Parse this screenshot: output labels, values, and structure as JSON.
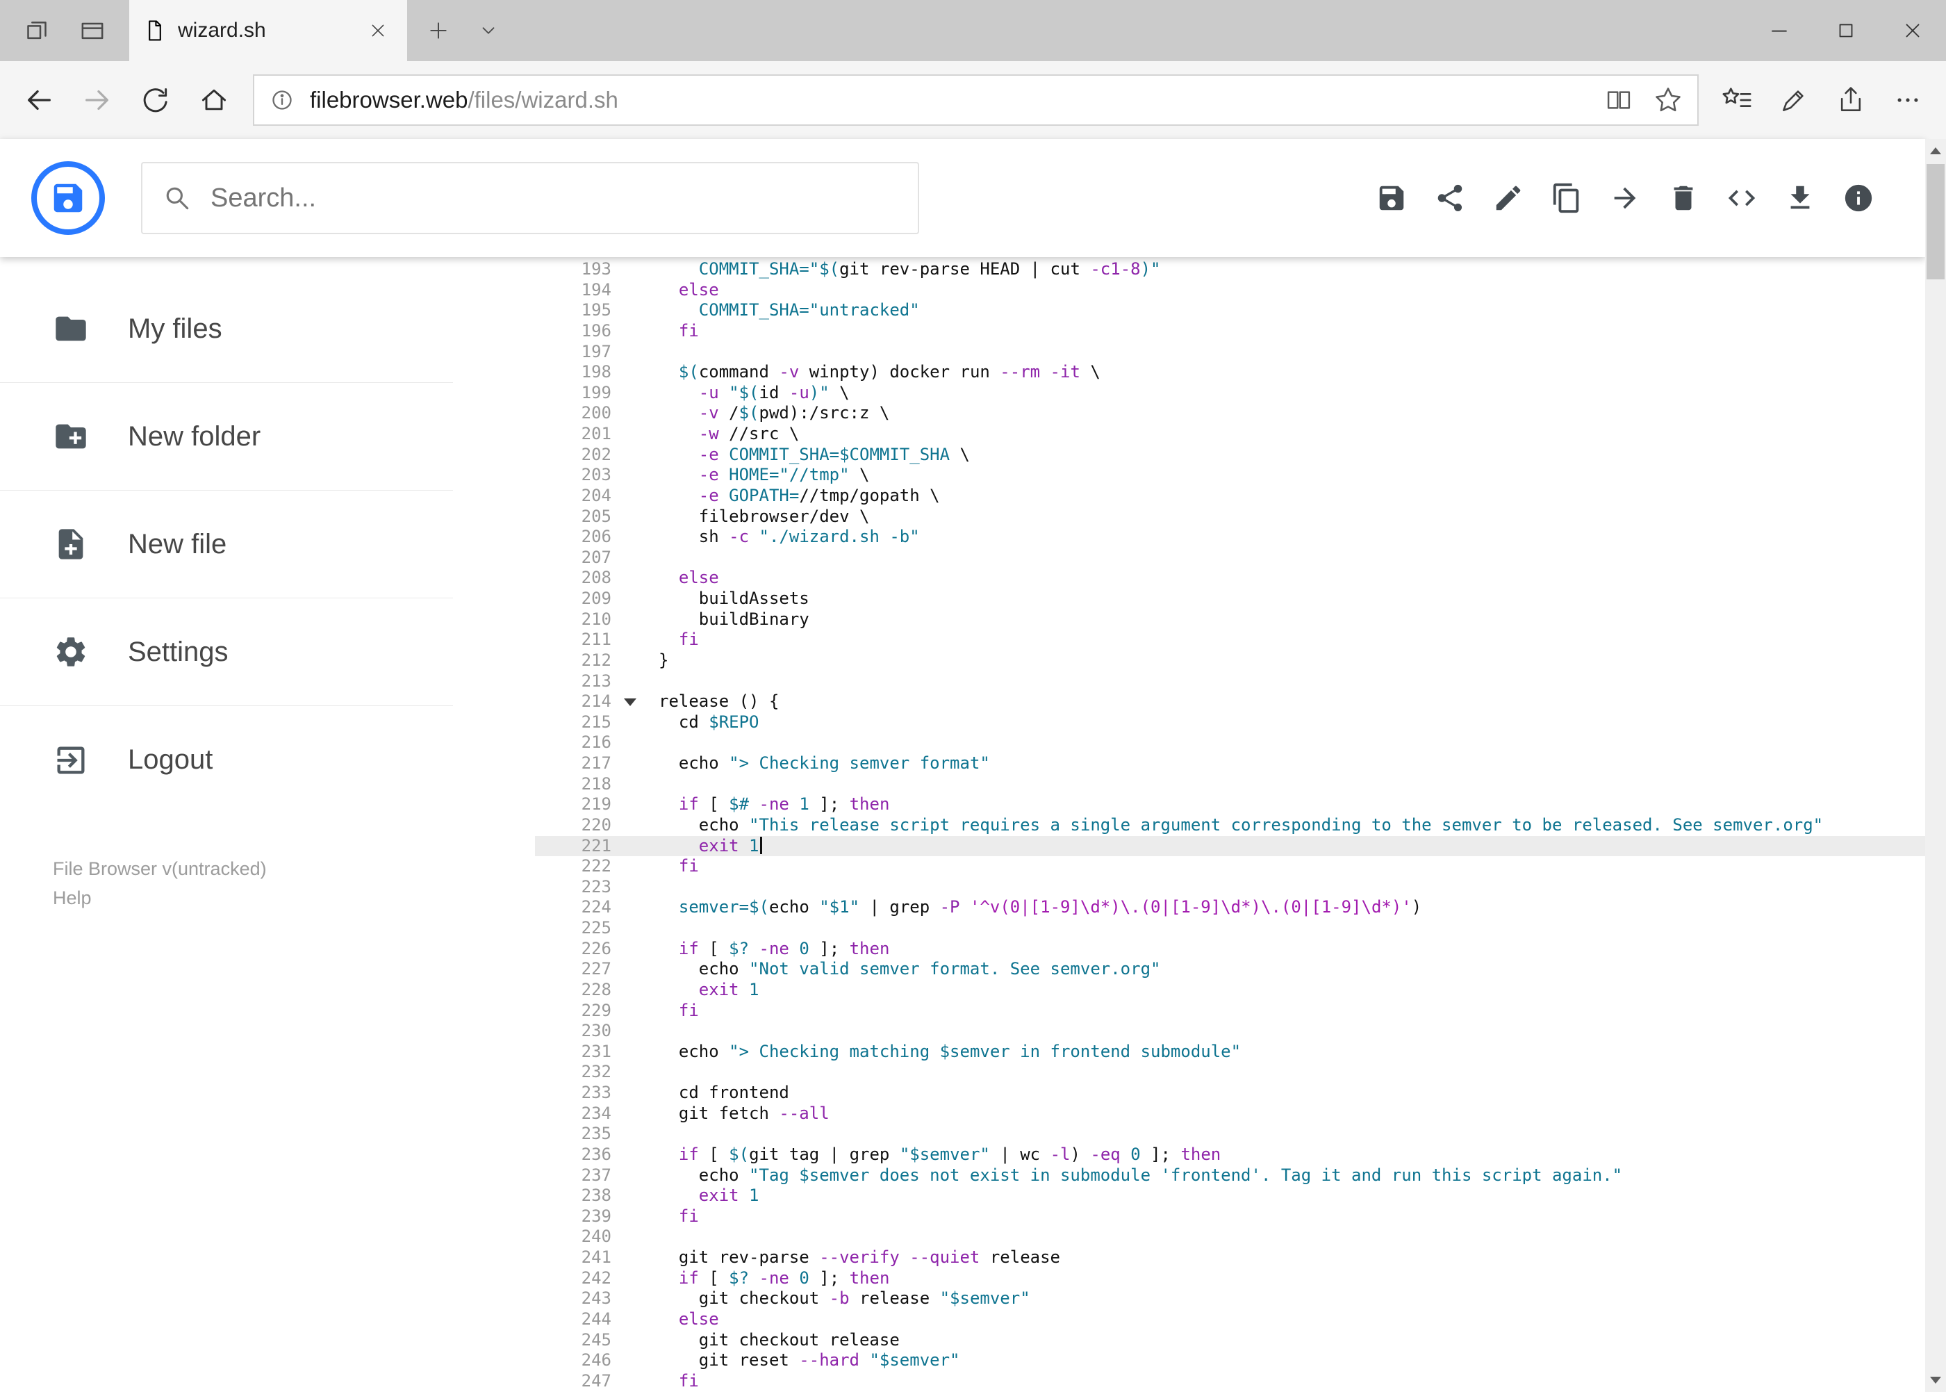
{
  "browser": {
    "tab_title": "wizard.sh",
    "url_host": "filebrowser.web",
    "url_path": "/files/wizard.sh"
  },
  "header": {
    "search_placeholder": "Search...",
    "toolbar_icons": [
      "save",
      "share",
      "rename",
      "copy",
      "move",
      "delete",
      "code",
      "download",
      "info"
    ]
  },
  "sidebar": {
    "items": [
      {
        "label": "My files",
        "icon": "folder-icon"
      },
      {
        "label": "New folder",
        "icon": "new-folder-icon"
      },
      {
        "label": "New file",
        "icon": "new-file-icon"
      },
      {
        "label": "Settings",
        "icon": "settings-icon"
      },
      {
        "label": "Logout",
        "icon": "logout-icon"
      }
    ],
    "footer_version": "File Browser v(untracked)",
    "footer_help": "Help"
  },
  "editor": {
    "language": "shell",
    "first_line": 193,
    "active_line": 221,
    "fold_marker_line": 214,
    "colors": {
      "accent": "#2979ff",
      "keyword": "#8e24aa",
      "string": "#0e7490",
      "regex": "#a21caf",
      "line_number": "#999999",
      "active_line_bg": "#ececec"
    },
    "lines": [
      "    COMMIT_SHA=\"$(git rev-parse HEAD | cut -c1-8)\"",
      "  else",
      "    COMMIT_SHA=\"untracked\"",
      "  fi",
      "",
      "  $(command -v winpty) docker run --rm -it \\",
      "    -u \"$(id -u)\" \\",
      "    -v /$(pwd):/src:z \\",
      "    -w //src \\",
      "    -e COMMIT_SHA=$COMMIT_SHA \\",
      "    -e HOME=\"//tmp\" \\",
      "    -e GOPATH=//tmp/gopath \\",
      "    filebrowser/dev \\",
      "    sh -c \"./wizard.sh -b\"",
      "",
      "  else",
      "    buildAssets",
      "    buildBinary",
      "  fi",
      "}",
      "",
      "release () {",
      "  cd $REPO",
      "",
      "  echo \"> Checking semver format\"",
      "",
      "  if [ $# -ne 1 ]; then",
      "    echo \"This release script requires a single argument corresponding to the semver to be released. See semver.org\"",
      "    exit 1",
      "  fi",
      "",
      "  semver=$(echo \"$1\" | grep -P '^v(0|[1-9]\\d*)\\.(0|[1-9]\\d*)\\.(0|[1-9]\\d*)')",
      "",
      "  if [ $? -ne 0 ]; then",
      "    echo \"Not valid semver format. See semver.org\"",
      "    exit 1",
      "  fi",
      "",
      "  echo \"> Checking matching $semver in frontend submodule\"",
      "",
      "  cd frontend",
      "  git fetch --all",
      "",
      "  if [ $(git tag | grep \"$semver\" | wc -l) -eq 0 ]; then",
      "    echo \"Tag $semver does not exist in submodule 'frontend'. Tag it and run this script again.\"",
      "    exit 1",
      "  fi",
      "",
      "  git rev-parse --verify --quiet release",
      "  if [ $? -ne 0 ]; then",
      "    git checkout -b release \"$semver\"",
      "  else",
      "    git checkout release",
      "    git reset --hard \"$semver\"",
      "  fi"
    ]
  }
}
